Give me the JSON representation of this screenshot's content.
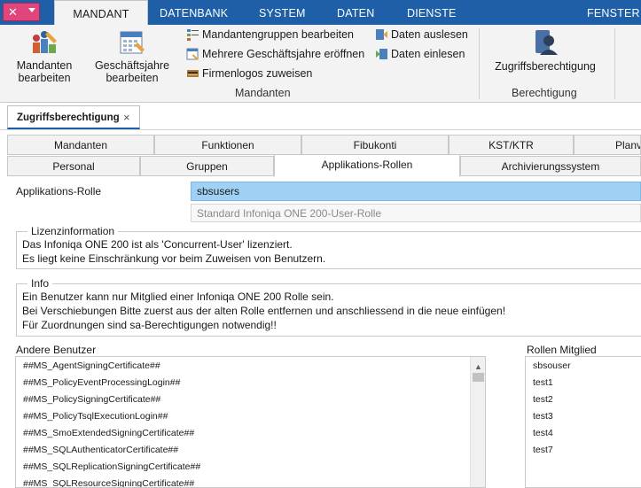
{
  "ribbon": {
    "tabs": [
      "MANDANT",
      "DATENBANK",
      "SYSTEM",
      "DATEN",
      "DIENSTE"
    ],
    "right_tab": "FENSTER",
    "mandanten": {
      "btn_mandanten": [
        "Mandanten",
        "bearbeiten"
      ],
      "btn_geschaeftsjahre": [
        "Geschäftsjahre",
        "bearbeiten"
      ],
      "small": [
        "Mandantengruppen bearbeiten",
        "Mehrere Geschäftsjahre eröffnen",
        "Firmenlogos zuweisen"
      ],
      "daten": [
        "Daten auslesen",
        "Daten einlesen"
      ],
      "group_label": "Mandanten"
    },
    "berechtigung": {
      "btn": "Zugriffsberechtigung",
      "group_label": "Berechtigung"
    }
  },
  "doc_tab": {
    "title": "Zugriffsberechtigung",
    "close": "×"
  },
  "tabs_row1": [
    "Mandanten",
    "Funktionen",
    "Fibukonti",
    "KST/KTR",
    "Planv"
  ],
  "tabs_row2": [
    "Personal",
    "Gruppen",
    "Applikations-Rollen",
    "Archivierungssystem"
  ],
  "role": {
    "label": "Applikations-Rolle",
    "value": "sbsusers",
    "description": "Standard Infoniqa ONE 200-User-Rolle"
  },
  "license": {
    "legend": "Lizenzinformation",
    "lines": [
      "Das Infoniqa ONE 200 ist als 'Concurrent-User' lizenziert.",
      "Es liegt keine Einschränkung vor beim Zuweisen von Benutzern."
    ]
  },
  "info": {
    "legend": "Info",
    "lines": [
      "Ein Benutzer kann nur Mitglied einer Infoniqa ONE 200 Rolle sein.",
      "Bei Verschiebungen Bitte zuerst aus der alten Rolle entfernen und anschliessend in die neue einfügen!",
      "Für Zuordnungen sind sa-Berechtigungen notwendig!!"
    ]
  },
  "other_users": {
    "label": "Andere Benutzer",
    "items": [
      "##MS_AgentSigningCertificate##",
      "##MS_PolicyEventProcessingLogin##",
      "##MS_PolicySigningCertificate##",
      "##MS_PolicyTsqlExecutionLogin##",
      "##MS_SmoExtendedSigningCertificate##",
      "##MS_SQLAuthenticatorCertificate##",
      "##MS_SQLReplicationSigningCertificate##",
      "##MS_SQLResourceSigningCertificate##"
    ]
  },
  "members": {
    "label": "Rollen Mitglied",
    "items": [
      "sbsouser",
      "test1",
      "test2",
      "test3",
      "test4",
      "test7"
    ]
  },
  "colors": {
    "ribbon_blue": "#1f5fa8",
    "app_button": "#e0457b",
    "selected_field": "#9fd1f5"
  }
}
